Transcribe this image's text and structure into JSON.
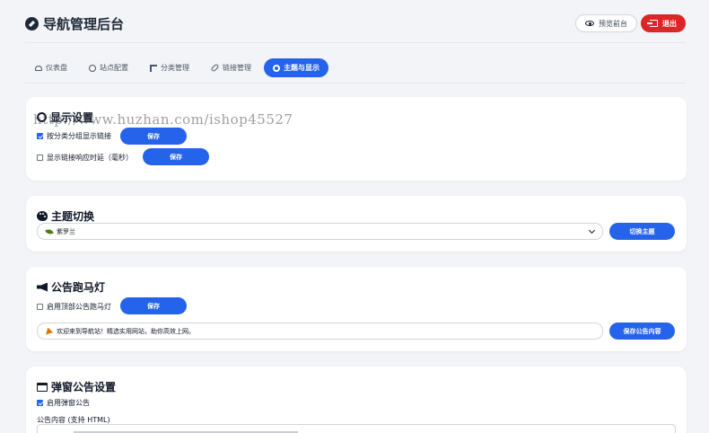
{
  "header": {
    "title": "导航管理后台",
    "preview_label": "预览前台",
    "logout_label": "退出"
  },
  "tabs": [
    {
      "label": "仪表盘",
      "icon": "dashboard-icon",
      "active": false
    },
    {
      "label": "站点配置",
      "icon": "globe-icon",
      "active": false
    },
    {
      "label": "分类管理",
      "icon": "sitemap-icon",
      "active": false
    },
    {
      "label": "链接管理",
      "icon": "link-icon",
      "active": false
    },
    {
      "label": "主题与显示",
      "icon": "gear-icon",
      "active": true
    }
  ],
  "display_settings": {
    "title": "显示设置",
    "group_by_category_label": "按分类分组显示链接",
    "group_by_category_checked": true,
    "group_save_label": "保存",
    "show_latency_label": "显示链接响应时延（毫秒）",
    "show_latency_checked": false,
    "latency_save_label": "保存"
  },
  "theme": {
    "title": "主题切换",
    "selected_theme": "紫罗兰",
    "switch_label": "切换主题"
  },
  "marquee": {
    "title": "公告跑马灯",
    "enable_label": "启用顶部公告跑马灯",
    "enable_checked": false,
    "save_label": "保存",
    "content_value": "欢迎来到导航站！精选实用网站，助你高效上网。",
    "save_content_label": "保存公告内容"
  },
  "popup": {
    "title": "弹窗公告设置",
    "enable_label": "启用弹窗公告",
    "enable_checked": true,
    "content_label": "公告内容 (支持 HTML)"
  },
  "watermark": "http://www.huzhan.com/ishop45527",
  "colors": {
    "accent": "#2563eb",
    "danger": "#dc2626",
    "background": "#f3f4f7"
  }
}
